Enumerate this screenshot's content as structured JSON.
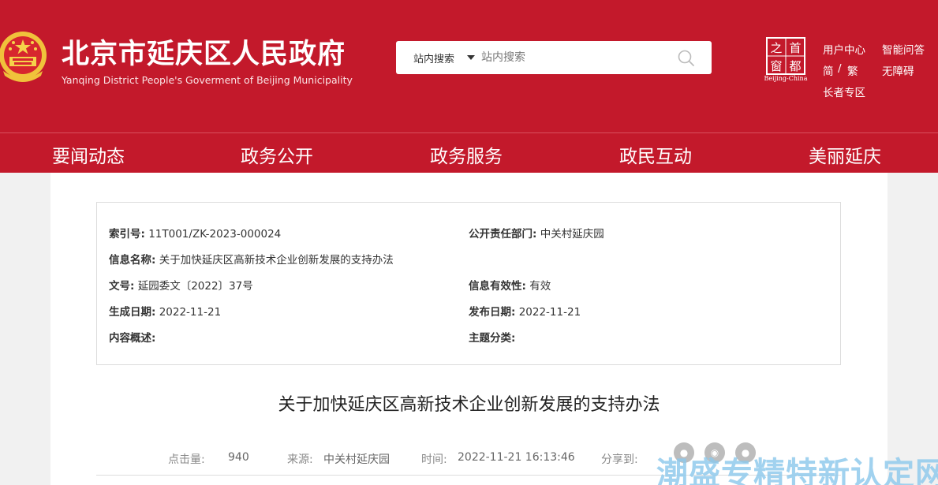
{
  "header": {
    "title": "北京市延庆区人民政府",
    "subtitle": "Yanqing District People's Goverment of Beijing Municipality",
    "brand_color": "#c3192b",
    "capital_logo": {
      "glyphs": [
        "首",
        "都",
        "之",
        "窗"
      ],
      "caption": "Beijing-China"
    },
    "links": {
      "user_center": "用户中心",
      "smart_qa": "智能问答",
      "simplified": "简",
      "separator": "/",
      "traditional": "繁",
      "accessibility": "无障碍",
      "elderly": "长者专区"
    }
  },
  "search": {
    "scope": "站内搜索",
    "placeholder": "站内搜索"
  },
  "nav": {
    "items": [
      "要闻动态",
      "政务公开",
      "政务服务",
      "政民互动",
      "美丽延庆"
    ]
  },
  "meta": {
    "index_no": {
      "label": "索引号:",
      "value": "11T001/ZK-2023-000024"
    },
    "department": {
      "label": "公开责任部门:",
      "value": "中关村延庆园"
    },
    "info_name": {
      "label": "信息名称:",
      "value": "关于加快延庆区高新技术企业创新发展的支持办法"
    },
    "doc_no": {
      "label": "文号:",
      "value": "延园委文〔2022〕37号"
    },
    "validity": {
      "label": "信息有效性:",
      "value": "有效"
    },
    "created": {
      "label": "生成日期:",
      "value": "2022-11-21"
    },
    "published": {
      "label": "发布日期:",
      "value": "2022-11-21"
    },
    "summary": {
      "label": "内容概述:",
      "value": ""
    },
    "topic": {
      "label": "主题分类:",
      "value": ""
    }
  },
  "article": {
    "title": "关于加快延庆区高新技术企业创新发展的支持办法",
    "clicks_label": "点击量:",
    "clicks": "940",
    "source_label": "来源:",
    "source": "中关村延庆园",
    "time_label": "时间:",
    "time": "2022-11-21 16:13:46",
    "share_label": "分享到:",
    "share_icons": [
      "wechat-icon",
      "weibo-icon",
      "qq-icon"
    ]
  },
  "watermark": "潮盛专精特新认定网"
}
